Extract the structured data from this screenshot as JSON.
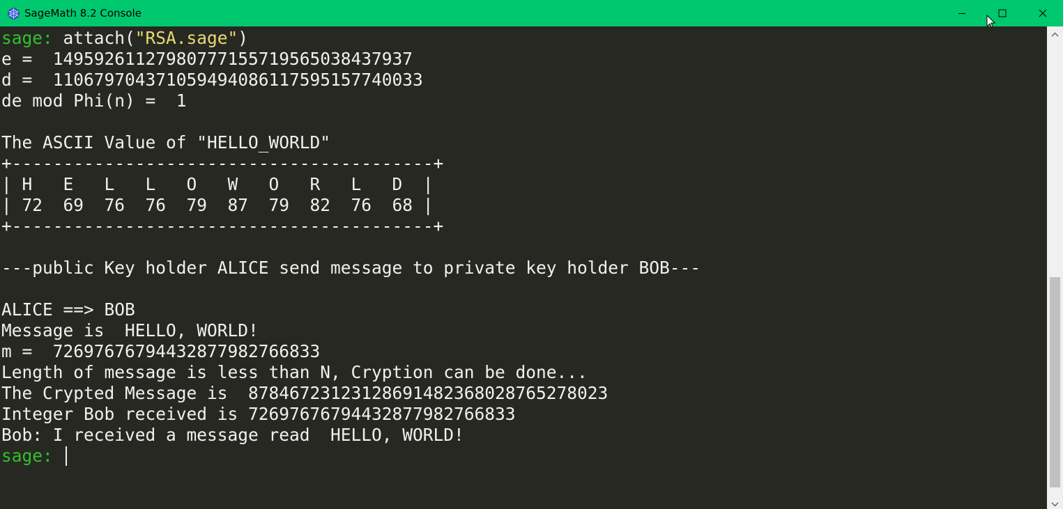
{
  "window": {
    "title": "SageMath 8.2 Console",
    "app_icon": "sagemath-icon",
    "controls": {
      "minimize": "minimize-icon",
      "maximize": "maximize-icon",
      "close": "close-icon"
    },
    "titlebar_color": "#00c86e"
  },
  "terminal": {
    "background": "#272822",
    "prompt_color": "#2ec32e",
    "string_color": "#e6db74",
    "text_color": "#f0f0f0",
    "command": {
      "prompt": "sage: ",
      "fn_open": "attach(",
      "arg": "\"RSA.sage\"",
      "fn_close": ")"
    },
    "output": {
      "e_line": "e =  149592611279807771557195650384379​37",
      "d_line": "d =  110679704371059494086117595157740033",
      "de_line": "de mod Phi(n) =  1",
      "ascii_heading": "The ASCII Value of \"HELLO_WORLD\"",
      "table_top": "+-----------------------------------------+",
      "table_row_letters": "| H   E   L   L   O   W   O   R   L   D  |",
      "table_row_values": "| 72  69  76  76  79  87  79  82  76  68 |",
      "table_bottom": "+-----------------------------------------+",
      "banner": "---public Key holder ALICE send message to private key holder BOB---",
      "direction": "ALICE ==> BOB",
      "message_line": "Message is  HELLO, WORLD!",
      "m_line": "m =  72697676794432877982766833",
      "length_line": "Length of message is less than N, Cryption can be done...",
      "crypted_line": "The Crypted Message is  878467231231286914823680287652780​23",
      "received_line": "Integer Bob received is 72697676794432877982766833",
      "bob_line": "Bob: I received a message read  HELLO, WORLD!"
    },
    "final_prompt": "sage: "
  },
  "scrollbar": {
    "up_icon": "scroll-up-arrow-icon",
    "down_icon": "scroll-down-arrow-icon"
  },
  "cursor_icon": "mouse-pointer-icon"
}
